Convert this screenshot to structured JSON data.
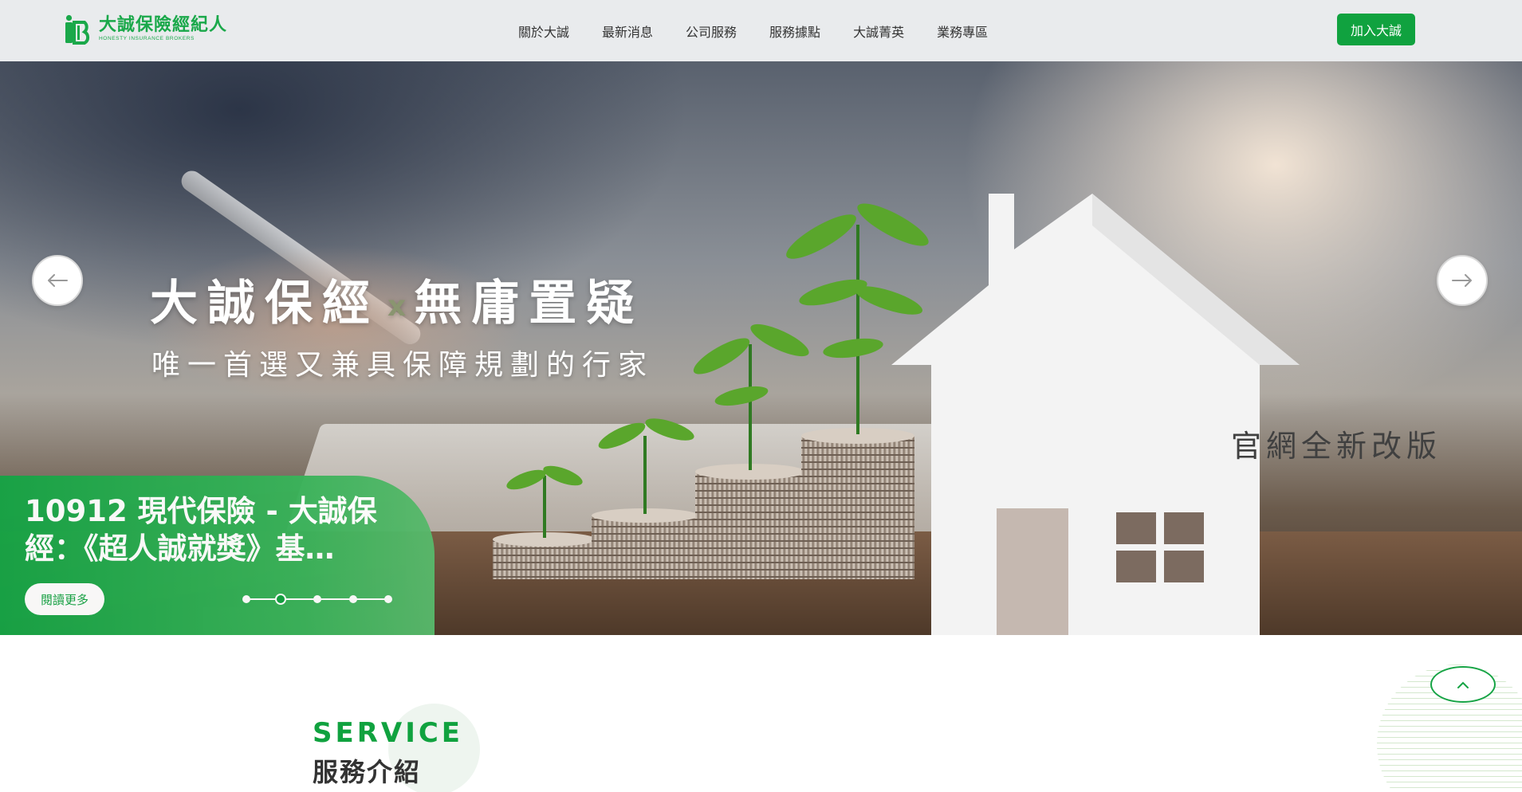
{
  "header": {
    "logo_cn": "大誠保險經紀人",
    "logo_en": "HONESTY INSURANCE BROKERS",
    "nav": [
      {
        "label": "關於大誠"
      },
      {
        "label": "最新消息"
      },
      {
        "label": "公司服務"
      },
      {
        "label": "服務據點"
      },
      {
        "label": "大誠菁英"
      },
      {
        "label": "業務專區"
      }
    ],
    "join_label": "加入大誠"
  },
  "hero": {
    "headline_left": "大誠保經",
    "headline_x": "x",
    "headline_right": "無庸置疑",
    "subline": "唯一首選又兼具保障規劃的行家",
    "renewal": "官網全新改版",
    "prev_icon": "arrow-left-icon",
    "next_icon": "arrow-right-icon"
  },
  "news": {
    "title": "10912 現代保險 - 大誠保經：《超人誠就獎》基…",
    "read_more_label": "閱讀更多",
    "dots_count": 5,
    "active_dot": 2
  },
  "service": {
    "en": "SERVICE",
    "cn": "服務介紹"
  },
  "back_to_top_icon": "chevron-up-icon",
  "colors": {
    "brand_green": "#10a23f",
    "header_bg": "#e9ebed",
    "text_dark": "#333333"
  }
}
